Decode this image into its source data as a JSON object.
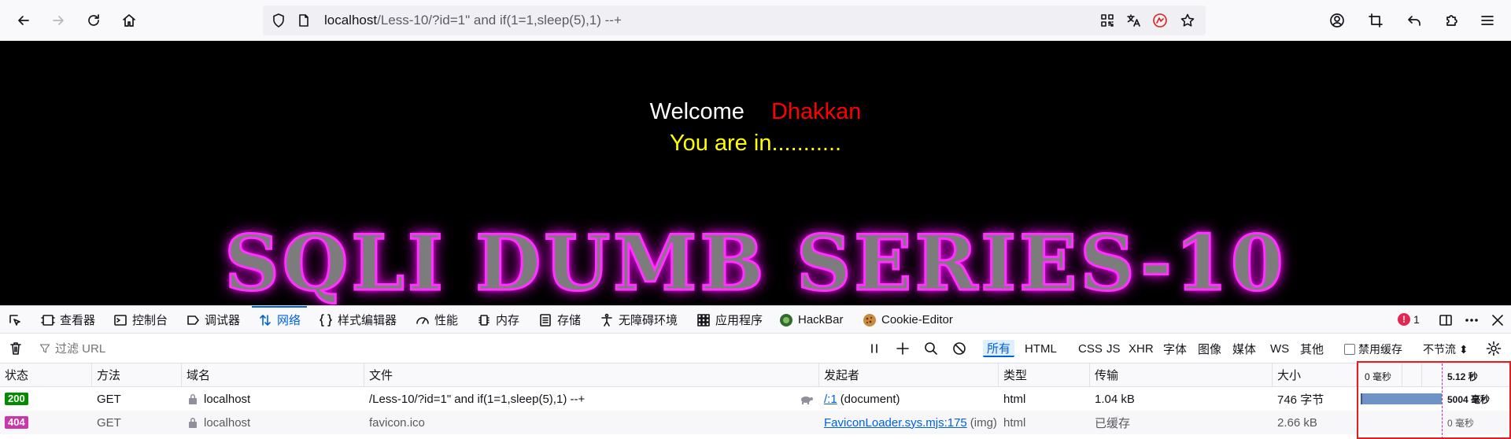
{
  "browser": {
    "url_host": "localhost",
    "url_path": "/Less-10/?id=1\" and if(1=1,sleep(5),1) --+",
    "icons": [
      "back-icon",
      "forward-icon",
      "reload-icon",
      "home-icon",
      "shield-icon",
      "page-icon",
      "qr-icon",
      "translate-icon",
      "extension-red-icon",
      "star-icon",
      "account-icon",
      "crop-icon",
      "undo-icon",
      "puzzle-icon",
      "menu-icon"
    ]
  },
  "page": {
    "welcome": "Welcome",
    "name": "Dhakkan",
    "status_text": "You are in...........",
    "banner": "SQLI DUMB SERIES-10"
  },
  "devtools": {
    "tabs": [
      {
        "label": "查看器",
        "icon": "inspector-icon"
      },
      {
        "label": "控制台",
        "icon": "console-icon"
      },
      {
        "label": "调试器",
        "icon": "debugger-icon"
      },
      {
        "label": "网络",
        "icon": "network-icon",
        "active": true
      },
      {
        "label": "样式编辑器",
        "icon": "style-editor-icon"
      },
      {
        "label": "性能",
        "icon": "performance-icon"
      },
      {
        "label": "内存",
        "icon": "memory-icon"
      },
      {
        "label": "存储",
        "icon": "storage-icon"
      },
      {
        "label": "无障碍环境",
        "icon": "accessibility-icon"
      },
      {
        "label": "应用程序",
        "icon": "application-icon"
      },
      {
        "label": "HackBar",
        "icon": "hackbar-icon"
      },
      {
        "label": "Cookie-Editor",
        "icon": "cookie-icon"
      }
    ],
    "error_count": "1",
    "filter_placeholder": "过滤 URL",
    "type_filters": [
      "所有",
      "HTML",
      "CSS",
      "JS",
      "XHR",
      "字体",
      "图像",
      "媒体",
      "WS",
      "其他"
    ],
    "disable_cache_label": "禁用缓存",
    "throttle_label": "不节流 ⬍"
  },
  "network": {
    "columns": [
      "状态",
      "方法",
      "域名",
      "文件",
      "发起者",
      "类型",
      "传输",
      "大小"
    ],
    "timeline": {
      "start_label": "0 毫秒",
      "end_label": "5.12 秒"
    },
    "rows": [
      {
        "status": "200",
        "status_color": "#058b00",
        "method": "GET",
        "domain": "localhost",
        "file": "/Less-10/?id=1\" and if(1=1,sleep(5),1) --+",
        "initiator_link": "/:1",
        "initiator_extra": "(document)",
        "type": "html",
        "transfer": "1.04 kB",
        "size": "746 字节",
        "timing": "5004 毫秒",
        "duration_ms": 5004
      },
      {
        "status": "404",
        "status_color": "#c837ab",
        "method": "GET",
        "domain": "localhost",
        "file": "favicon.ico",
        "initiator_link": "FaviconLoader.sys.mjs:175",
        "initiator_extra": "(img)",
        "type": "html",
        "transfer": "已缓存",
        "size": "2.66 kB",
        "timing": "0 毫秒",
        "duration_ms": 0
      }
    ]
  }
}
